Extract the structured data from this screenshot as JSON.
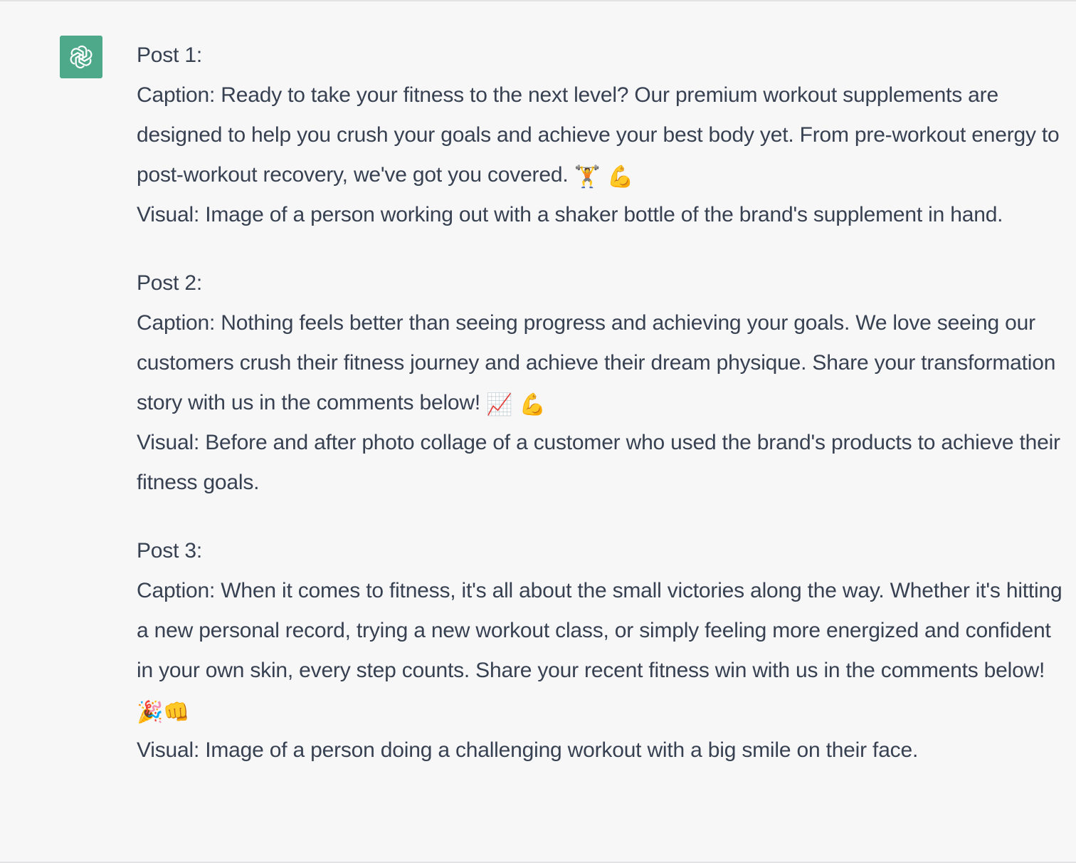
{
  "brand_color": "#4ea98a",
  "assistant": {
    "avatar_icon": "openai-logo-icon"
  },
  "posts": [
    {
      "heading": "Post 1:",
      "caption": "Caption: Ready to take your fitness to the next level? Our premium workout supplements are designed to help you crush your goals and achieve your best body yet. From pre-workout energy to post-workout recovery, we've got you covered.",
      "caption_emojis": "🏋️ 💪",
      "visual": "Visual: Image of a person working out with a shaker bottle of the brand's supplement in hand."
    },
    {
      "heading": "Post 2:",
      "caption": "Caption: Nothing feels better than seeing progress and achieving your goals. We love seeing our customers crush their fitness journey and achieve their dream physique. Share your transformation story with us in the comments below!",
      "caption_emojis": "📈 💪",
      "visual": "Visual: Before and after photo collage of a customer who used the brand's products to achieve their fitness goals."
    },
    {
      "heading": "Post 3:",
      "caption": "Caption: When it comes to fitness, it's all about the small victories along the way. Whether it's hitting a new personal record, trying a new workout class, or simply feeling more energized and confident in your own skin, every step counts. Share your recent fitness win with us in the comments below!",
      "caption_emojis": "🎉👊",
      "visual": "Visual: Image of a person doing a challenging workout with a big smile on their face."
    }
  ]
}
